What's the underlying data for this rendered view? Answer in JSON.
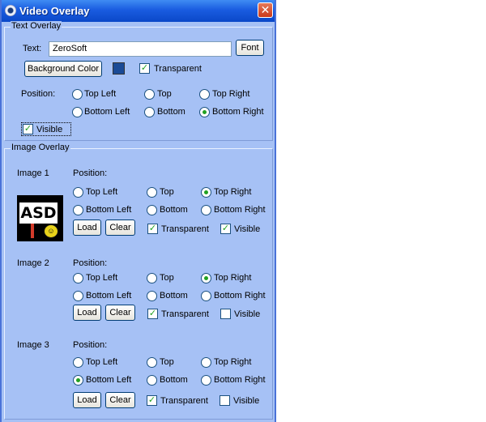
{
  "window": {
    "title": "Video Overlay",
    "close_glyph": "✕"
  },
  "text_overlay": {
    "legend": "Text Overlay",
    "text_label": "Text:",
    "text_value": "ZeroSoft",
    "font_button": "Font",
    "bg_color_button": "Background Color",
    "bg_color": "#1a4a96",
    "transparent_label": "Transparent",
    "transparent_checked": true,
    "position_label": "Position:",
    "positions": [
      "Top Left",
      "Top",
      "Top Right",
      "Bottom Left",
      "Bottom",
      "Bottom Right"
    ],
    "selected_position": "Bottom Right",
    "visible_label": "Visible",
    "visible_checked": true
  },
  "image_overlay": {
    "legend": "Image Overlay",
    "images": [
      {
        "label": "Image 1",
        "position_label": "Position:",
        "selected": "Top Right",
        "load": "Load",
        "clear": "Clear",
        "transparent": "Transparent",
        "visible": "Visible",
        "transparent_checked": true,
        "visible_checked": true,
        "thumb_text": "ASD"
      },
      {
        "label": "Image 2",
        "position_label": "Position:",
        "selected": "Top Right",
        "load": "Load",
        "clear": "Clear",
        "transparent": "Transparent",
        "visible": "Visible",
        "transparent_checked": true,
        "visible_checked": false
      },
      {
        "label": "Image 3",
        "position_label": "Position:",
        "selected": "Bottom Left",
        "load": "Load",
        "clear": "Clear",
        "transparent": "Transparent",
        "visible": "Visible",
        "transparent_checked": true,
        "visible_checked": false
      }
    ],
    "positions": [
      "Top Left",
      "Top",
      "Top Right",
      "Bottom Left",
      "Bottom",
      "Bottom Right"
    ]
  },
  "icons": {
    "app": "app-icon",
    "close": "close-icon",
    "check": "✓"
  }
}
